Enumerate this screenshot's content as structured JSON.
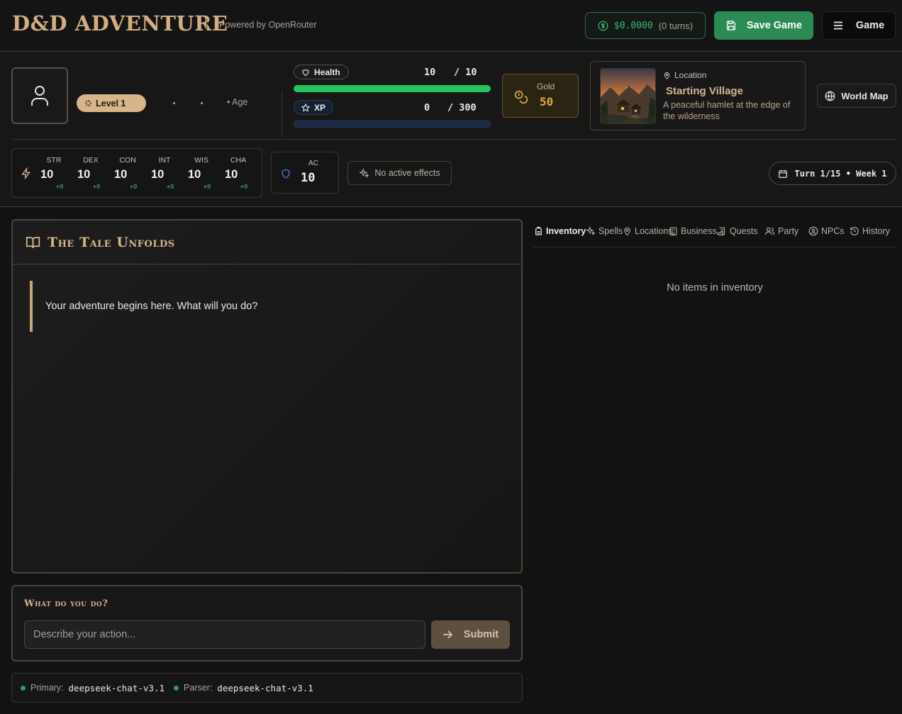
{
  "header": {
    "brand": "D&D ADVENTURE",
    "powered_by": "Powered by OpenRouter",
    "cost": "$0.0000",
    "turns": "(0 turns)",
    "save_label": "Save Game",
    "game_label": "Game"
  },
  "character": {
    "level": "Level 1",
    "age": "• Age",
    "health": {
      "label": "Health",
      "current": "10",
      "max": "/ 10",
      "fraction": 1.0,
      "color": "#25c45f"
    },
    "xp": {
      "label": "XP",
      "current": "0",
      "max": "/ 300",
      "fraction": 0.0,
      "color": "#3b6fd1"
    },
    "gold": {
      "label": "Gold",
      "value": "50"
    },
    "location": {
      "label": "Location",
      "name": "Starting Village",
      "description": "A peaceful hamlet at the edge of the wilderness"
    },
    "world_map_label": "World Map",
    "attributes": [
      {
        "abbr": "STR",
        "value": "10",
        "mod": "+0"
      },
      {
        "abbr": "DEX",
        "value": "10",
        "mod": "+0"
      },
      {
        "abbr": "CON",
        "value": "10",
        "mod": "+0"
      },
      {
        "abbr": "INT",
        "value": "10",
        "mod": "+0"
      },
      {
        "abbr": "WIS",
        "value": "10",
        "mod": "+0"
      },
      {
        "abbr": "CHA",
        "value": "10",
        "mod": "+0"
      }
    ],
    "ac": {
      "label": "AC",
      "value": "10"
    },
    "effects": "No active effects",
    "turn": "Turn 1/15 • Week 1"
  },
  "story": {
    "title": "The Tale Unfolds",
    "entries": [
      "Your adventure begins here. What will you do?"
    ]
  },
  "action": {
    "label": "What do you do?",
    "placeholder": "Describe your action...",
    "submit_label": "Submit"
  },
  "models": {
    "primary_label": "Primary:",
    "primary": "deepseek-chat-v3.1",
    "parser_label": "Parser:",
    "parser": "deepseek-chat-v3.1"
  },
  "tabs": [
    {
      "label": "Inventory",
      "icon": "backpack-icon",
      "active": true
    },
    {
      "label": "Spells",
      "icon": "sparkles-icon"
    },
    {
      "label": "Locations",
      "icon": "map-pin-icon"
    },
    {
      "label": "Business",
      "icon": "building-icon"
    },
    {
      "label": "Quests",
      "icon": "scroll-icon"
    },
    {
      "label": "Party",
      "icon": "users-icon"
    },
    {
      "label": "NPCs",
      "icon": "user-circle-icon"
    },
    {
      "label": "History",
      "icon": "history-icon"
    }
  ],
  "inventory_empty": "No items in inventory",
  "colors": {
    "accent": "#d2ae82",
    "save_green": "#2c8a55",
    "gold": "#e0a93a",
    "panel_border": "#4f4334"
  }
}
